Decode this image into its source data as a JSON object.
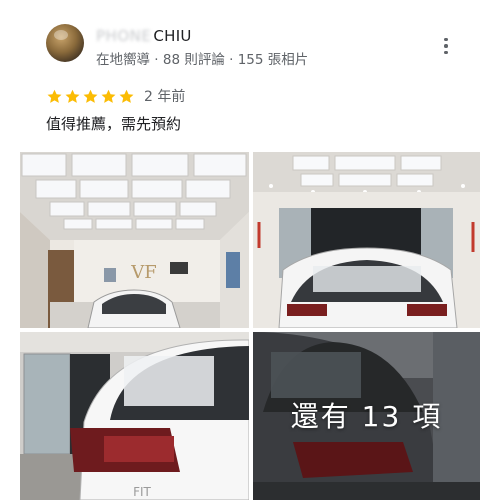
{
  "reviewer": {
    "name_prefix_blurred": "PHONE",
    "name": "CHIU",
    "meta": "在地嚮導 · 88 則評論 · 155 張相片"
  },
  "rating": {
    "stars": 5,
    "time_ago": "2 年前"
  },
  "review_text": "值得推薦，需先預約",
  "photos": {
    "more_count_label": "還有 13 項"
  },
  "icons": {
    "star": "star-icon",
    "more": "more-vert-icon"
  },
  "colors": {
    "star": "#fbbc04",
    "meta_text": "#5f6368",
    "body_text": "#202124"
  }
}
